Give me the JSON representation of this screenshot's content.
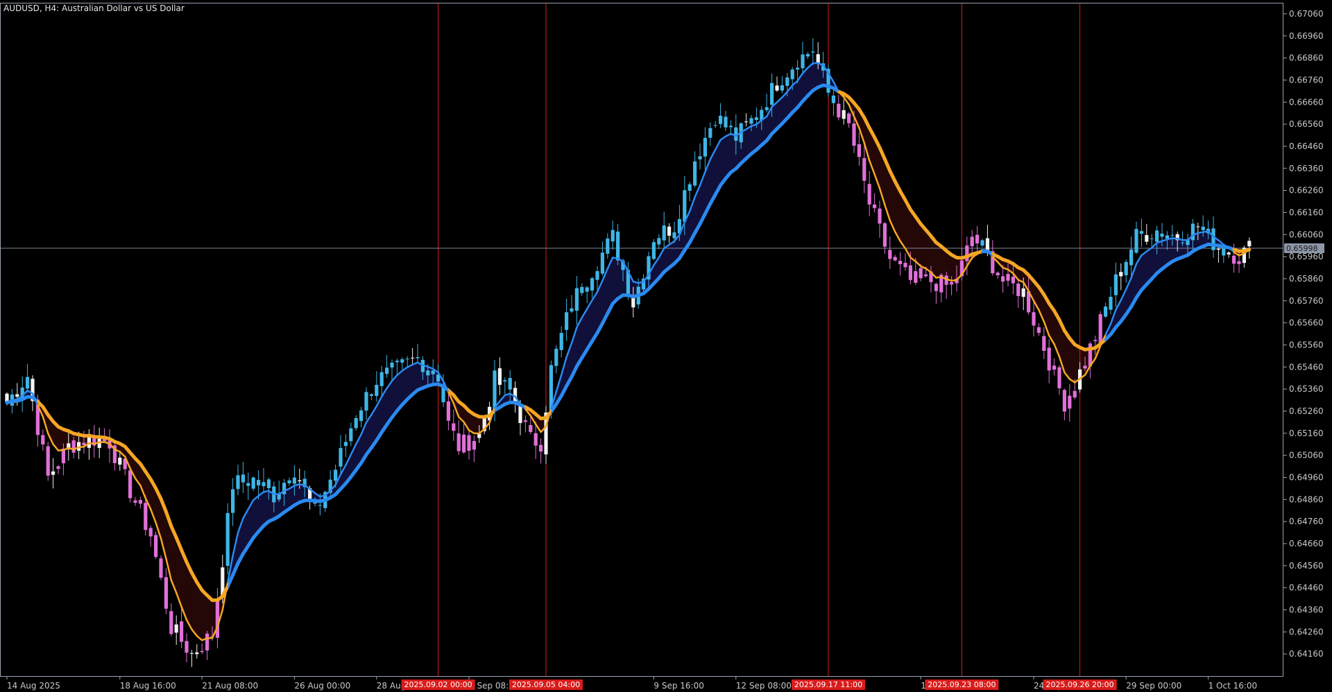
{
  "chart_data": {
    "type": "candlestick",
    "title": "AUDUSD, H4:  Australian Dollar vs US Dollar",
    "y_range": [
      0.6406,
      0.6711
    ],
    "y_ticks": [
      "0.67060",
      "0.66960",
      "0.66860",
      "0.66760",
      "0.66660",
      "0.66560",
      "0.66460",
      "0.66360",
      "0.66260",
      "0.66160",
      "0.66060",
      "0.65960",
      "0.65860",
      "0.65760",
      "0.65660",
      "0.65560",
      "0.65460",
      "0.65360",
      "0.65260",
      "0.65160",
      "0.65060",
      "0.64960",
      "0.64860",
      "0.64760",
      "0.64660",
      "0.64560",
      "0.64460",
      "0.64360",
      "0.64260",
      "0.64160"
    ],
    "x_labels": [
      {
        "text": "14 Aug 2025",
        "i": 0
      },
      {
        "text": "18 Aug 16:00",
        "i": 22
      },
      {
        "text": "21 Aug 08:00",
        "i": 38
      },
      {
        "text": "26 Aug 00:00",
        "i": 56
      },
      {
        "text": "28 Aug 16:00",
        "i": 72
      },
      {
        "text": "3 Sep 08:00",
        "i": 90
      },
      {
        "text": "9 Sep 16:00",
        "i": 126
      },
      {
        "text": "12 Sep 08:00",
        "i": 142
      },
      {
        "text": "19 Sep 00:00",
        "i": 178
      },
      {
        "text": "24 Sep 08:00",
        "i": 200
      },
      {
        "text": "29 Sep 00:00",
        "i": 218
      },
      {
        "text": "1 Oct 16:00",
        "i": 234
      }
    ],
    "vlines": [
      {
        "label": "2025.09.02 00:00",
        "i": 84
      },
      {
        "label": "2025.09.05 04:00",
        "i": 105
      },
      {
        "label": "2025.09.17 11:00",
        "i": 160
      },
      {
        "label": "2025.09.23 08:00",
        "i": 186
      },
      {
        "label": "2025.09.26 20:00",
        "i": 209
      }
    ],
    "current_price": 0.65998,
    "current_price_label": "0.65998",
    "colors": {
      "bull": "#3fb6e6",
      "bear": "#e070d8",
      "neutral": "#f2f2f2",
      "fast_ma": "#f5a623",
      "slow_ma_up": "#2a8af0",
      "slow_ma_down": "#f5a623",
      "fill_up": "#10103a",
      "fill_down": "#240808",
      "vline": "#d91c1c",
      "grid": "#9aa4b2",
      "axis": "#9aa4b2"
    },
    "anchors": [
      [
        0,
        0.653
      ],
      [
        4,
        0.6542
      ],
      [
        8,
        0.6496
      ],
      [
        12,
        0.651
      ],
      [
        16,
        0.6514
      ],
      [
        20,
        0.6512
      ],
      [
        24,
        0.649
      ],
      [
        28,
        0.647
      ],
      [
        32,
        0.6428
      ],
      [
        36,
        0.6416
      ],
      [
        40,
        0.6425
      ],
      [
        44,
        0.6493
      ],
      [
        48,
        0.6495
      ],
      [
        52,
        0.6488
      ],
      [
        56,
        0.65
      ],
      [
        60,
        0.648
      ],
      [
        64,
        0.65
      ],
      [
        68,
        0.6525
      ],
      [
        72,
        0.654
      ],
      [
        76,
        0.6545
      ],
      [
        80,
        0.655
      ],
      [
        84,
        0.6542
      ],
      [
        86,
        0.652
      ],
      [
        88,
        0.651
      ],
      [
        92,
        0.6515
      ],
      [
        95,
        0.654
      ],
      [
        98,
        0.6535
      ],
      [
        102,
        0.6513
      ],
      [
        104,
        0.6512
      ],
      [
        106,
        0.6545
      ],
      [
        110,
        0.6575
      ],
      [
        114,
        0.659
      ],
      [
        118,
        0.6605
      ],
      [
        122,
        0.6575
      ],
      [
        126,
        0.6605
      ],
      [
        130,
        0.661
      ],
      [
        134,
        0.664
      ],
      [
        138,
        0.666
      ],
      [
        142,
        0.665
      ],
      [
        146,
        0.666
      ],
      [
        150,
        0.6675
      ],
      [
        154,
        0.6685
      ],
      [
        157,
        0.669
      ],
      [
        160,
        0.667
      ],
      [
        164,
        0.6655
      ],
      [
        168,
        0.662
      ],
      [
        172,
        0.6595
      ],
      [
        176,
        0.6585
      ],
      [
        180,
        0.6585
      ],
      [
        184,
        0.6582
      ],
      [
        186,
        0.6592
      ],
      [
        188,
        0.6605
      ],
      [
        190,
        0.66
      ],
      [
        194,
        0.6585
      ],
      [
        198,
        0.658
      ],
      [
        202,
        0.6555
      ],
      [
        206,
        0.653
      ],
      [
        208,
        0.6538
      ],
      [
        212,
        0.656
      ],
      [
        216,
        0.6585
      ],
      [
        220,
        0.6605
      ],
      [
        224,
        0.6608
      ],
      [
        228,
        0.6605
      ],
      [
        232,
        0.661
      ],
      [
        236,
        0.66
      ],
      [
        240,
        0.6596
      ],
      [
        242,
        0.66
      ]
    ]
  }
}
